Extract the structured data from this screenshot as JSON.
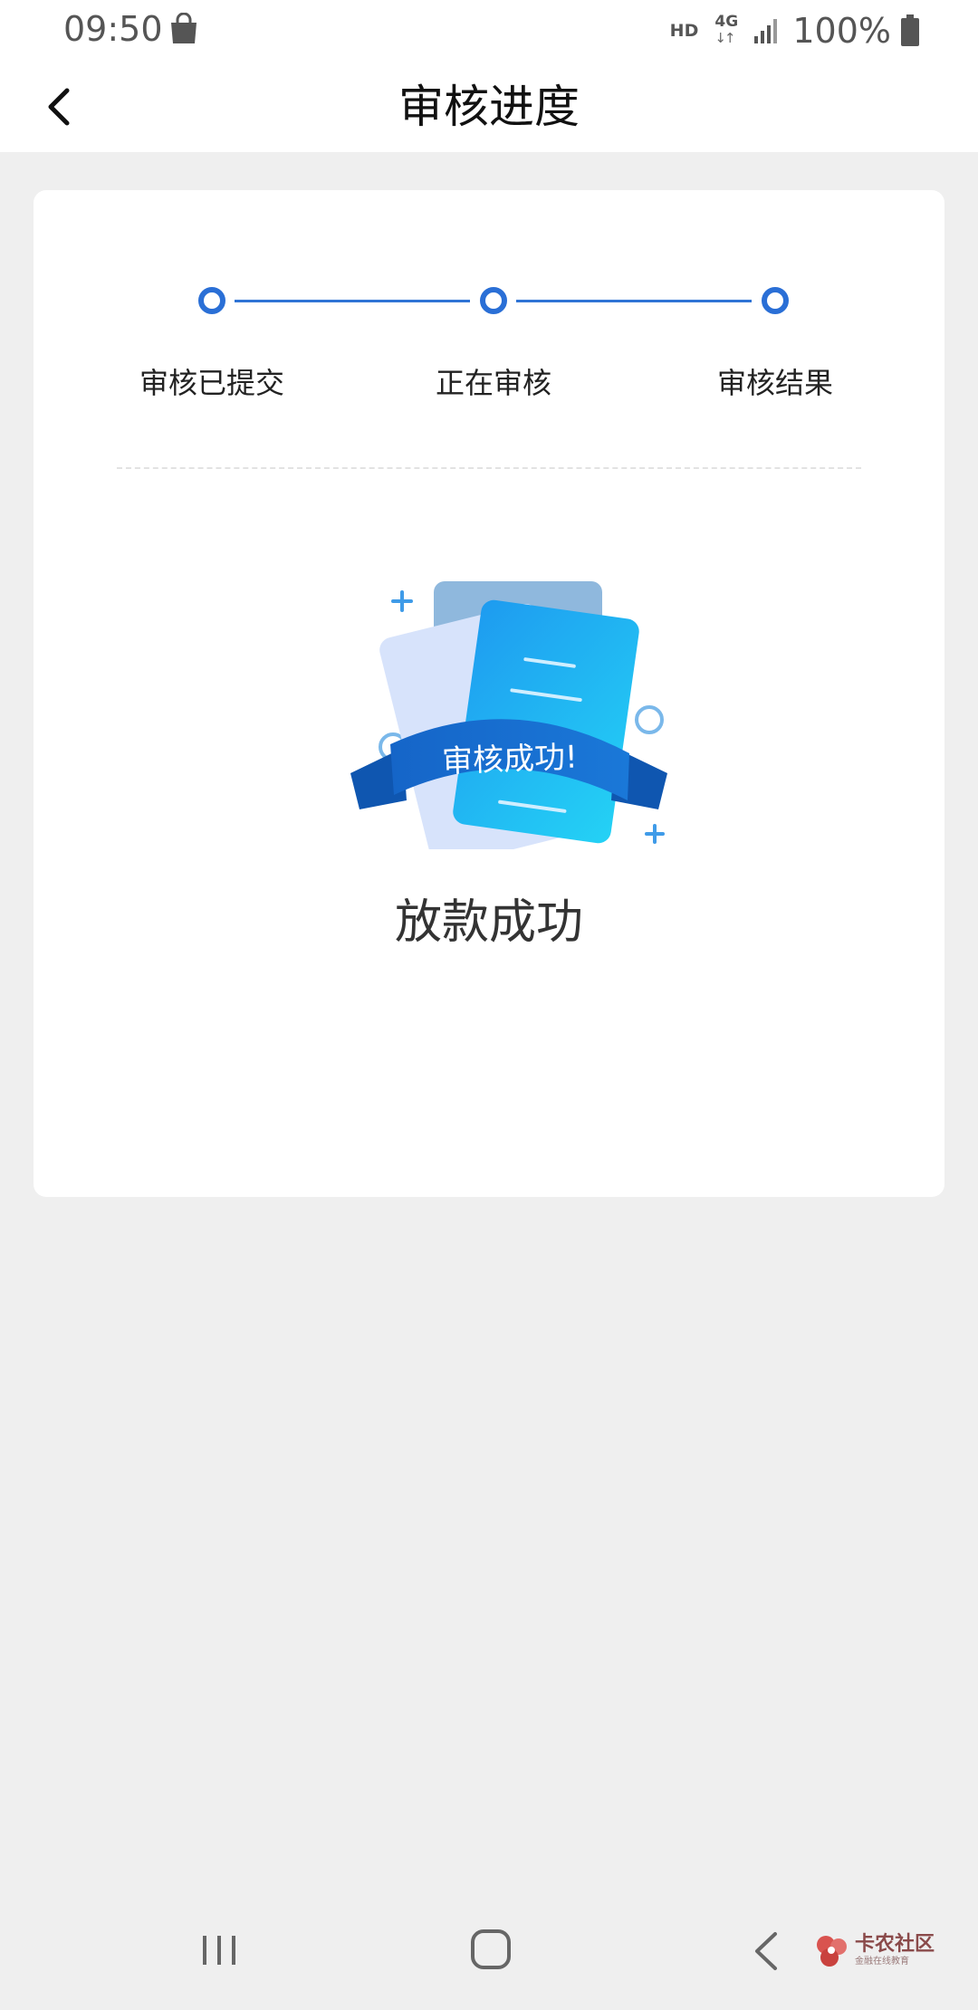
{
  "status_bar": {
    "time": "09:50",
    "hd": "HD",
    "network": "4G",
    "network_arrows": "↓↑",
    "battery": "100%"
  },
  "header": {
    "title": "审核进度"
  },
  "steps": [
    {
      "label": "审核已提交"
    },
    {
      "label": "正在审核"
    },
    {
      "label": "审核结果"
    }
  ],
  "illustration": {
    "ribbon_text": "审核成功!"
  },
  "result": {
    "text": "放款成功"
  },
  "watermark": {
    "title": "卡农社区",
    "subtitle": "金融在线教育"
  },
  "colors": {
    "accent": "#2a6fd6",
    "background": "#efefef"
  }
}
